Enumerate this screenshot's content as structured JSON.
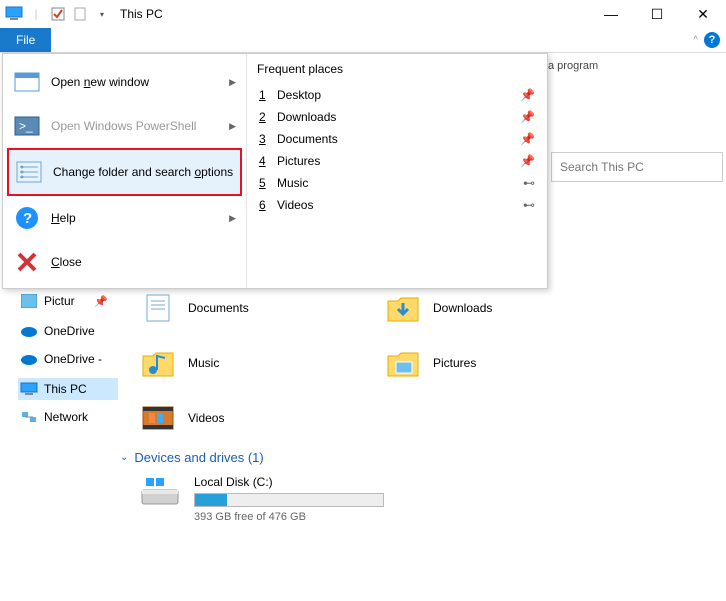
{
  "window": {
    "title": "This PC",
    "min": "—",
    "max": "☐",
    "close": "✕"
  },
  "ribbon": {
    "file_tab": "File",
    "help_chevron": "^",
    "help_q": "?",
    "rc_line": "a program"
  },
  "file_menu": {
    "open_win": "Open new window",
    "powershell": "Open Windows PowerShell",
    "change_folder": "Change folder and search options",
    "help": "Help",
    "close": "Close"
  },
  "frequent": {
    "title": "Frequent places",
    "items": [
      {
        "n": "1",
        "label": "Desktop",
        "pin": "📌"
      },
      {
        "n": "2",
        "label": "Downloads",
        "pin": "📌"
      },
      {
        "n": "3",
        "label": "Documents",
        "pin": "📌"
      },
      {
        "n": "4",
        "label": "Pictures",
        "pin": "📌"
      },
      {
        "n": "5",
        "label": "Music",
        "pin": "⊷"
      },
      {
        "n": "6",
        "label": "Videos",
        "pin": "⊷"
      }
    ]
  },
  "search": {
    "placeholder": "Search This PC"
  },
  "nav": {
    "pictures": "Pictur",
    "onedrive1": "OneDrive",
    "onedrive2": "OneDrive -",
    "thispc": "This PC",
    "network": "Network"
  },
  "folders": {
    "documents": "Documents",
    "downloads": "Downloads",
    "music": "Music",
    "pictures": "Pictures",
    "videos": "Videos"
  },
  "devices": {
    "header": "Devices and drives (1)",
    "drive_name": "Local Disk (C:)",
    "drive_free": "393 GB free of 476 GB",
    "fill_pct": 17
  }
}
